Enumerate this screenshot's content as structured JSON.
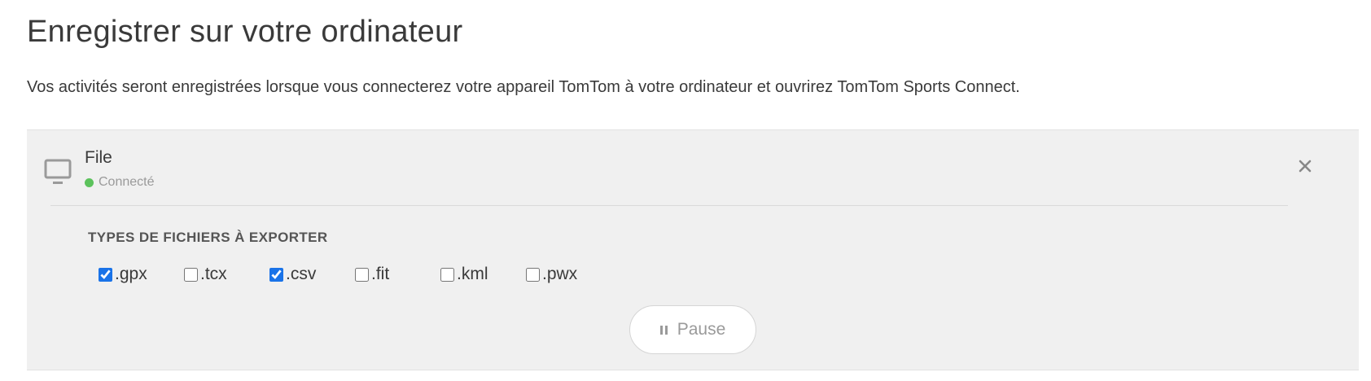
{
  "page": {
    "title": "Enregistrer sur votre ordinateur",
    "description": "Vos activités seront enregistrées lorsque vous connecterez votre appareil TomTom à votre ordinateur et ouvrirez TomTom Sports Connect."
  },
  "connection": {
    "icon": "monitor-icon",
    "name": "File",
    "status": "Connecté",
    "status_color": "#5cc25c",
    "close_icon": "close-icon"
  },
  "export": {
    "heading": "TYPES DE FICHIERS À EXPORTER",
    "file_types": [
      {
        "label": ".gpx",
        "checked": true
      },
      {
        "label": ".tcx",
        "checked": false
      },
      {
        "label": ".csv",
        "checked": true
      },
      {
        "label": ".fit",
        "checked": false
      },
      {
        "label": ".kml",
        "checked": false
      },
      {
        "label": ".pwx",
        "checked": false
      }
    ]
  },
  "pause_button": {
    "icon": "pause-icon",
    "label": "Pause"
  }
}
